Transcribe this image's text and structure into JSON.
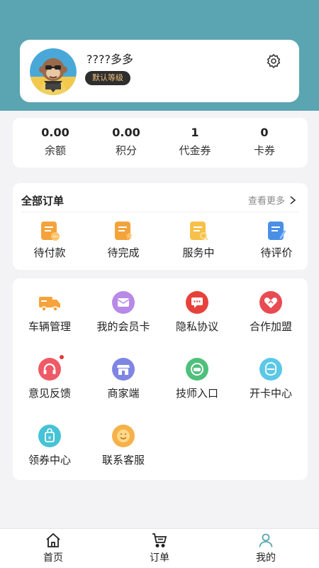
{
  "profile": {
    "nickname": "????多多",
    "level": "默认等级"
  },
  "stats": [
    {
      "value": "0.00",
      "label": "余额"
    },
    {
      "value": "0.00",
      "label": "积分"
    },
    {
      "value": "1",
      "label": "代金券"
    },
    {
      "value": "0",
      "label": "卡券"
    }
  ],
  "orders": {
    "title": "全部订单",
    "see_more": "查看更多",
    "items": [
      {
        "label": "待付款",
        "icon": "pending-payment-icon"
      },
      {
        "label": "待完成",
        "icon": "pending-complete-icon"
      },
      {
        "label": "服务中",
        "icon": "in-service-icon"
      },
      {
        "label": "待评价",
        "icon": "pending-review-icon"
      }
    ]
  },
  "services": [
    {
      "label": "车辆管理",
      "icon": "truck-icon",
      "color": "#f5a33a"
    },
    {
      "label": "我的会员卡",
      "icon": "member-card-icon",
      "color": "#b889e6"
    },
    {
      "label": "隐私协议",
      "icon": "chat-bubble-icon",
      "color": "#e8413b"
    },
    {
      "label": "合作加盟",
      "icon": "heart-handshake-icon",
      "color": "#e94b53"
    },
    {
      "label": "意见反馈",
      "icon": "headset-icon",
      "color": "#ef5a67"
    },
    {
      "label": "商家端",
      "icon": "store-icon",
      "color": "#7f85e3"
    },
    {
      "label": "技师入口",
      "icon": "technician-icon",
      "color": "#4fc07b"
    },
    {
      "label": "开卡中心",
      "icon": "card-center-icon",
      "color": "#5cc8e8"
    },
    {
      "label": "领券中心",
      "icon": "coupon-bag-icon",
      "color": "#46c3d6"
    },
    {
      "label": "联系客服",
      "icon": "smile-service-icon",
      "color": "#f5b24a"
    }
  ],
  "tabbar": [
    {
      "label": "首页",
      "icon": "home-icon"
    },
    {
      "label": "订单",
      "icon": "cart-icon"
    },
    {
      "label": "我的",
      "icon": "user-icon",
      "active_color": "#5aa5b1"
    }
  ]
}
